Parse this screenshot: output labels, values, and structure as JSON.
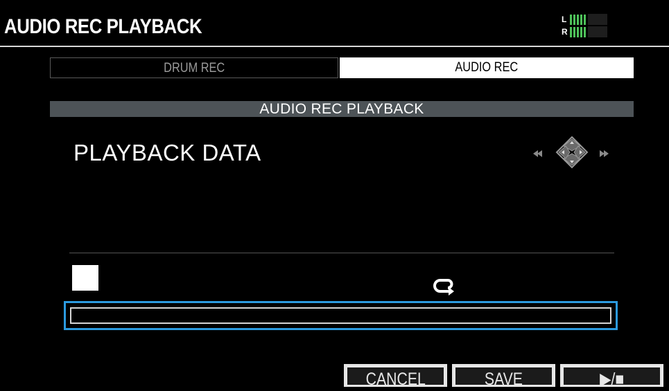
{
  "header": {
    "title": "AUDIO REC PLAYBACK",
    "meter": {
      "left_label": "L",
      "right_label": "R",
      "bar_color": "#4ec25a"
    }
  },
  "tabs": [
    {
      "label": "DRUM REC",
      "active": false
    },
    {
      "label": "AUDIO REC",
      "active": true
    }
  ],
  "section": {
    "title": "AUDIO REC PLAYBACK"
  },
  "parameter": {
    "label": "PLAYBACK DATA",
    "nav_icon": "cursor-pad-icon",
    "rewind_icon": "rewind-icon",
    "fast_forward_icon": "fast-forward-icon"
  },
  "transport": {
    "stop_icon": "stop-square-icon",
    "loop_icon": "loop-icon"
  },
  "data_field": {
    "value": "",
    "focus_color": "#2c9be0"
  },
  "function_buttons": [
    {
      "label": "CANCEL"
    },
    {
      "label": "SAVE"
    },
    {
      "label": "▶/■"
    }
  ]
}
